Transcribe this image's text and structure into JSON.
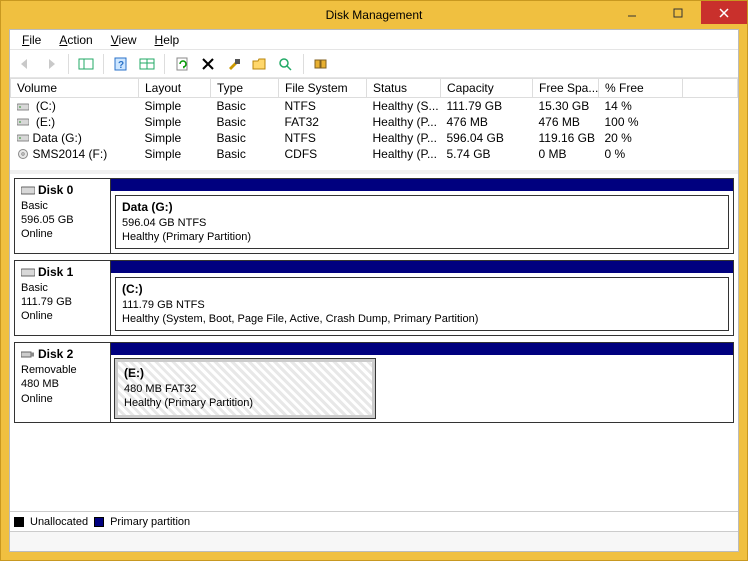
{
  "window": {
    "title": "Disk Management"
  },
  "menu": {
    "file": "File",
    "action": "Action",
    "view": "View",
    "help": "Help"
  },
  "columns": {
    "volume": "Volume",
    "layout": "Layout",
    "type": "Type",
    "fs": "File System",
    "status": "Status",
    "capacity": "Capacity",
    "free": "Free Spa...",
    "pctfree": "% Free"
  },
  "volumes": [
    {
      "name": " (C:)",
      "layout": "Simple",
      "type": "Basic",
      "fs": "NTFS",
      "status": "Healthy (S...",
      "capacity": "111.79 GB",
      "free": "15.30 GB",
      "pct": "14 %",
      "icon": "hdd"
    },
    {
      "name": " (E:)",
      "layout": "Simple",
      "type": "Basic",
      "fs": "FAT32",
      "status": "Healthy (P...",
      "capacity": "476 MB",
      "free": "476 MB",
      "pct": "100 %",
      "icon": "hdd"
    },
    {
      "name": "Data (G:)",
      "layout": "Simple",
      "type": "Basic",
      "fs": "NTFS",
      "status": "Healthy (P...",
      "capacity": "596.04 GB",
      "free": "119.16 GB",
      "pct": "20 %",
      "icon": "hdd"
    },
    {
      "name": "SMS2014 (F:)",
      "layout": "Simple",
      "type": "Basic",
      "fs": "CDFS",
      "status": "Healthy (P...",
      "capacity": "5.74 GB",
      "free": "0 MB",
      "pct": "0 %",
      "icon": "cd"
    }
  ],
  "disks": [
    {
      "label": "Disk 0",
      "type": "Basic",
      "size": "596.05 GB",
      "state": "Online",
      "media": "hdd",
      "part": {
        "name": "Data  (G:)",
        "line2": "596.04 GB NTFS",
        "line3": "Healthy (Primary Partition)"
      },
      "hatched": false,
      "narrow": false
    },
    {
      "label": "Disk 1",
      "type": "Basic",
      "size": "111.79 GB",
      "state": "Online",
      "media": "hdd",
      "part": {
        "name": "(C:)",
        "line2": "111.79 GB NTFS",
        "line3": "Healthy (System, Boot, Page File, Active, Crash Dump, Primary Partition)"
      },
      "hatched": false,
      "narrow": false
    },
    {
      "label": "Disk 2",
      "type": "Removable",
      "size": "480 MB",
      "state": "Online",
      "media": "usb",
      "part": {
        "name": "(E:)",
        "line2": "480 MB FAT32",
        "line3": "Healthy (Primary Partition)"
      },
      "hatched": true,
      "narrow": true
    }
  ],
  "legend": {
    "unallocated": "Unallocated",
    "primary": "Primary partition"
  }
}
